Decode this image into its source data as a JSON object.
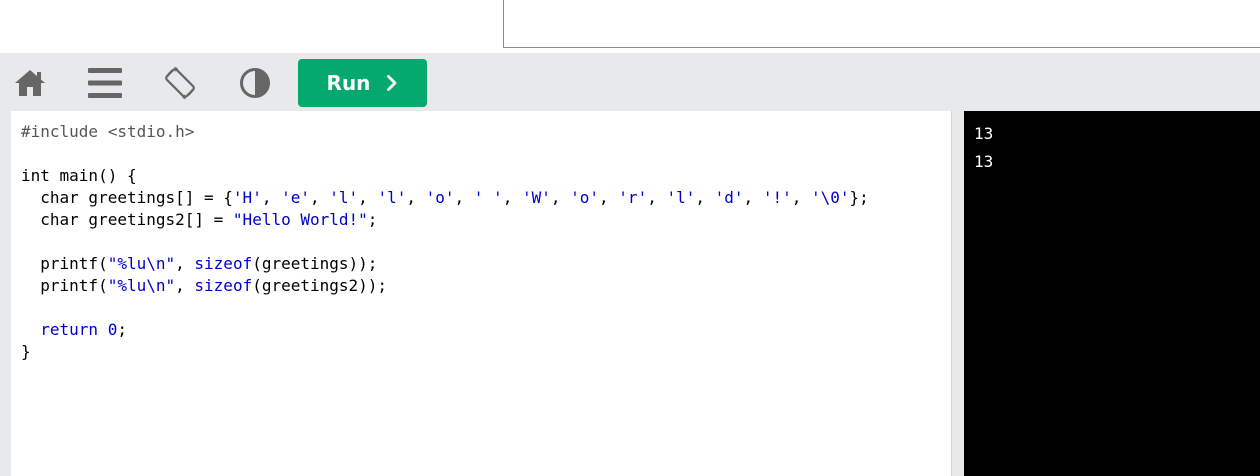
{
  "toolbar": {
    "icons": [
      "home-icon",
      "menu-icon",
      "rotate-screen-icon",
      "contrast-icon"
    ],
    "run_label": "Run",
    "run_color": "#04aa6d"
  },
  "editor": {
    "language": "C",
    "lines": [
      [
        {
          "t": "#include <stdio.h>",
          "c": "pre"
        }
      ],
      [],
      [
        {
          "t": "int main() {",
          "c": "plain"
        }
      ],
      [
        {
          "t": "  char greetings[] = {",
          "c": "plain"
        },
        {
          "t": "'H'",
          "c": "str"
        },
        {
          "t": ", ",
          "c": "plain"
        },
        {
          "t": "'e'",
          "c": "str"
        },
        {
          "t": ", ",
          "c": "plain"
        },
        {
          "t": "'l'",
          "c": "str"
        },
        {
          "t": ", ",
          "c": "plain"
        },
        {
          "t": "'l'",
          "c": "str"
        },
        {
          "t": ", ",
          "c": "plain"
        },
        {
          "t": "'o'",
          "c": "str"
        },
        {
          "t": ", ",
          "c": "plain"
        },
        {
          "t": "' '",
          "c": "str"
        },
        {
          "t": ", ",
          "c": "plain"
        },
        {
          "t": "'W'",
          "c": "str"
        },
        {
          "t": ", ",
          "c": "plain"
        },
        {
          "t": "'o'",
          "c": "str"
        },
        {
          "t": ", ",
          "c": "plain"
        },
        {
          "t": "'r'",
          "c": "str"
        },
        {
          "t": ", ",
          "c": "plain"
        },
        {
          "t": "'l'",
          "c": "str"
        },
        {
          "t": ", ",
          "c": "plain"
        },
        {
          "t": "'d'",
          "c": "str"
        },
        {
          "t": ", ",
          "c": "plain"
        },
        {
          "t": "'!'",
          "c": "str"
        },
        {
          "t": ", ",
          "c": "plain"
        },
        {
          "t": "'\\0'",
          "c": "str"
        },
        {
          "t": "};",
          "c": "plain"
        }
      ],
      [
        {
          "t": "  char greetings2[] = ",
          "c": "plain"
        },
        {
          "t": "\"Hello World!\"",
          "c": "str"
        },
        {
          "t": ";",
          "c": "plain"
        }
      ],
      [],
      [
        {
          "t": "  printf(",
          "c": "plain"
        },
        {
          "t": "\"%lu\\n\"",
          "c": "str"
        },
        {
          "t": ", ",
          "c": "plain"
        },
        {
          "t": "sizeof",
          "c": "kw"
        },
        {
          "t": "(greetings));",
          "c": "plain"
        }
      ],
      [
        {
          "t": "  printf(",
          "c": "plain"
        },
        {
          "t": "\"%lu\\n\"",
          "c": "str"
        },
        {
          "t": ", ",
          "c": "plain"
        },
        {
          "t": "sizeof",
          "c": "kw"
        },
        {
          "t": "(greetings2));",
          "c": "plain"
        }
      ],
      [],
      [
        {
          "t": "  ",
          "c": "plain"
        },
        {
          "t": "return",
          "c": "kw"
        },
        {
          "t": " ",
          "c": "plain"
        },
        {
          "t": "0",
          "c": "str"
        },
        {
          "t": ";",
          "c": "plain"
        }
      ],
      [
        {
          "t": "}",
          "c": "plain"
        }
      ]
    ]
  },
  "output": {
    "lines": [
      "13",
      "13"
    ]
  }
}
